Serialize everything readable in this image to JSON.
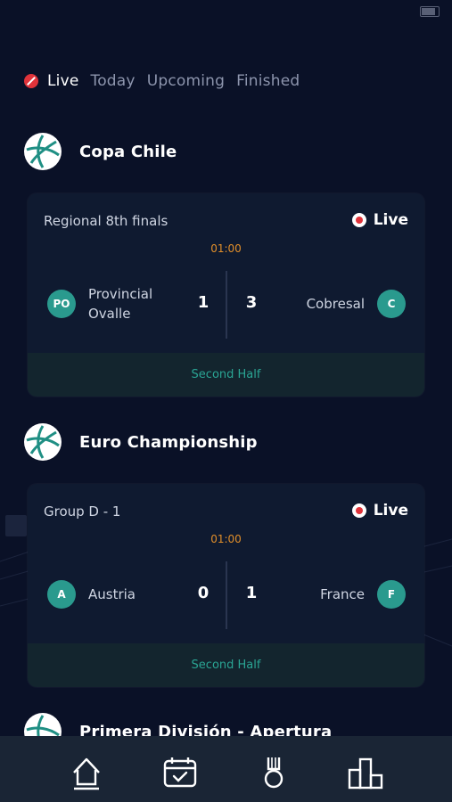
{
  "tabs": [
    {
      "label": "Live"
    },
    {
      "label": "Today"
    },
    {
      "label": "Upcoming"
    },
    {
      "label": "Finished"
    }
  ],
  "leagues": [
    {
      "name": "Copa Chile",
      "match": {
        "round": "Regional 8th finals",
        "live_label": "Live",
        "time": "01:00",
        "home": {
          "badge": "PO",
          "name": "Provincial Ovalle",
          "score": "1"
        },
        "away": {
          "badge": "C",
          "name": "Cobresal",
          "score": "3"
        },
        "period": "Second Half"
      }
    },
    {
      "name": "Euro Championship",
      "match": {
        "round": "Group D - 1",
        "live_label": "Live",
        "time": "01:00",
        "home": {
          "badge": "A",
          "name": "Austria",
          "score": "0"
        },
        "away": {
          "badge": "F",
          "name": "France",
          "score": "1"
        },
        "period": "Second Half"
      }
    },
    {
      "name": "Primera División - Apertura"
    }
  ],
  "bottom_nav": [
    {
      "icon": "home-icon"
    },
    {
      "icon": "calendar-check-icon"
    },
    {
      "icon": "medal-icon"
    },
    {
      "icon": "podium-icon"
    }
  ],
  "colors": {
    "background": "#0a1127",
    "card": "#0f1a30",
    "accent_teal": "#2a9a8e",
    "live_red": "#e0333a",
    "time_orange": "#e28f2a"
  }
}
